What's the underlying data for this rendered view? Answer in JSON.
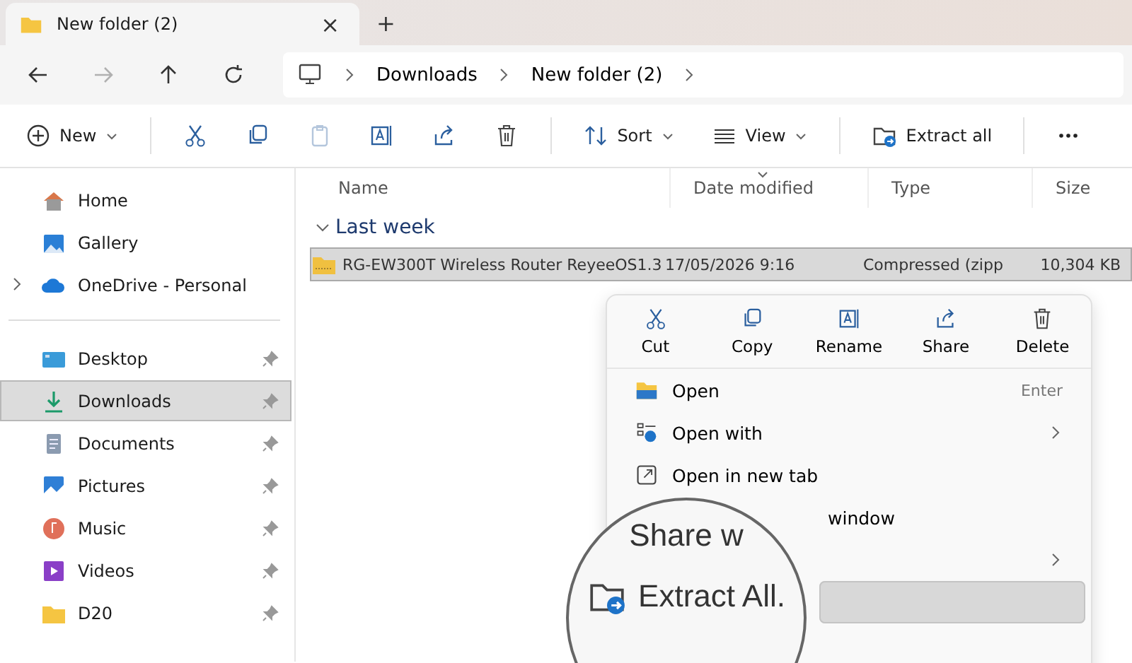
{
  "tab": {
    "title": "New folder (2)",
    "close": "×",
    "add": "+"
  },
  "nav": [
    {
      "kind": "back",
      "disabled": false
    },
    {
      "kind": "forward",
      "disabled": true
    },
    {
      "kind": "up",
      "disabled": false
    },
    {
      "kind": "refresh",
      "disabled": false
    }
  ],
  "breadcrumb": [
    "Downloads",
    "New folder (2)"
  ],
  "toolbar": [
    {
      "kind": "new",
      "label": "New",
      "disabled": false
    },
    {
      "kind": "cut",
      "disabled": false
    },
    {
      "kind": "copy",
      "disabled": false
    },
    {
      "kind": "paste",
      "disabled": true
    },
    {
      "kind": "rename",
      "disabled": false
    },
    {
      "kind": "share",
      "disabled": false
    },
    {
      "kind": "delete",
      "disabled": false
    },
    {
      "kind": "sort",
      "label": "Sort",
      "disabled": false
    },
    {
      "kind": "view",
      "label": "View",
      "disabled": false
    },
    {
      "kind": "extract",
      "label": "Extract all",
      "disabled": false
    },
    {
      "kind": "more",
      "disabled": false
    }
  ],
  "sidebar": {
    "groups": [
      {
        "items": [
          {
            "kind": "home",
            "label": "Home",
            "selected": false,
            "pinned": false,
            "expandable": false
          },
          {
            "kind": "gallery",
            "label": "Gallery",
            "selected": false,
            "pinned": false,
            "expandable": false
          },
          {
            "kind": "cloud",
            "label": "OneDrive - Personal",
            "selected": false,
            "pinned": false,
            "expandable": true
          }
        ]
      },
      {
        "items": [
          {
            "kind": "desktop",
            "label": "Desktop",
            "selected": false,
            "pinned": true,
            "expandable": false
          },
          {
            "kind": "download",
            "label": "Downloads",
            "selected": true,
            "pinned": true,
            "expandable": false
          },
          {
            "kind": "document",
            "label": "Documents",
            "selected": false,
            "pinned": true,
            "expandable": false
          },
          {
            "kind": "picture",
            "label": "Pictures",
            "selected": false,
            "pinned": true,
            "expandable": false
          },
          {
            "kind": "music",
            "label": "Music",
            "selected": false,
            "pinned": true,
            "expandable": false
          },
          {
            "kind": "video",
            "label": "Videos",
            "selected": false,
            "pinned": true,
            "expandable": false
          },
          {
            "kind": "folder",
            "label": "D20",
            "selected": false,
            "pinned": true,
            "expandable": false
          }
        ]
      }
    ]
  },
  "columns": [
    {
      "label": "Name",
      "sorted": false
    },
    {
      "label": "Date modified",
      "sorted": true
    },
    {
      "label": "Type",
      "sorted": false
    },
    {
      "label": "Size",
      "sorted": false
    }
  ],
  "group": {
    "label": "Last week",
    "expanded": true,
    "rows": [
      {
        "name": "RG-EW300T Wireless Router ReyeeOS1.3",
        "date": "17/05/2026 9:16",
        "type": "Compressed (zipp",
        "size": "10,304 KB",
        "selected": true
      }
    ]
  },
  "context_menu": {
    "actions": [
      {
        "kind": "cut",
        "label": "Cut"
      },
      {
        "kind": "copy",
        "label": "Copy"
      },
      {
        "kind": "rename",
        "label": "Rename"
      },
      {
        "kind": "share",
        "label": "Share"
      },
      {
        "kind": "delete",
        "label": "Delete"
      }
    ],
    "items": [
      {
        "kind": "open",
        "label": "Open",
        "shortcut": "Enter",
        "submenu": false,
        "selected": false
      },
      {
        "kind": "openwith",
        "label": "Open with",
        "submenu": true,
        "selected": false
      },
      {
        "kind": "newtab",
        "label": "Open in new tab",
        "submenu": false,
        "selected": false
      },
      {
        "kind": "plain",
        "label": "window",
        "submenu": false,
        "selected": false
      },
      {
        "kind": "plain",
        "submenu": true,
        "selected": false
      },
      {
        "kind": "plain",
        "submenu": false,
        "selected": true
      }
    ]
  },
  "magnifier": [
    {
      "kind": "share",
      "label": "Share w"
    },
    {
      "kind": "extract",
      "label": "Extract All."
    }
  ]
}
